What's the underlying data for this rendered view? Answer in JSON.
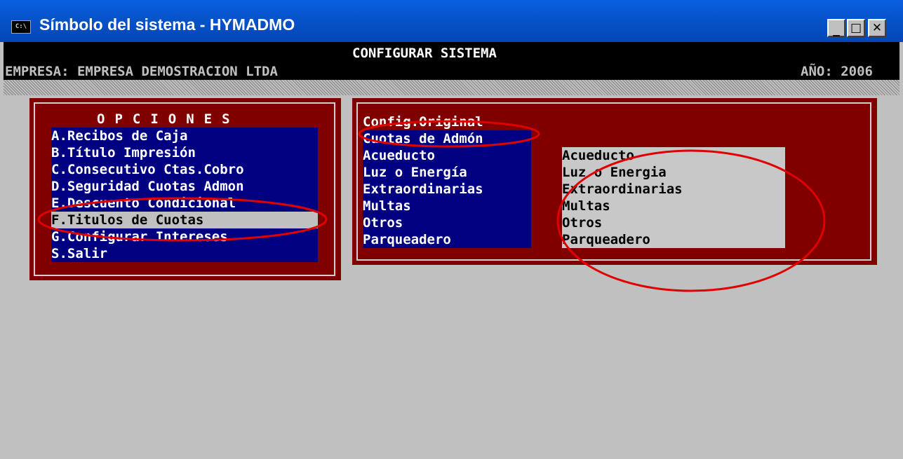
{
  "window": {
    "title": "Símbolo del sistema - HYMADMO",
    "icon": "cmd-icon"
  },
  "controls": {
    "minimize": "_",
    "maximize": "□",
    "close": "✕"
  },
  "header": {
    "screen_title": "CONFIGURAR SISTEMA",
    "company": "EMPRESA: EMPRESA DEMOSTRACION LTDA",
    "year": "AÑO: 2006"
  },
  "menu": {
    "title": "OPCIONES",
    "items": [
      "A.Recibos de Caja",
      "B.Título Impresión",
      "C.Consecutivo Ctas.Cobro",
      "D.Seguridad Cuotas Admon",
      "E.Descuento Condicional",
      "F.Titulos de Cuotas",
      "G.Configurar Intereses",
      "S.Salir"
    ],
    "selected": "F.Titulos de Cuotas"
  },
  "right_panel": {
    "labels": [
      "Config.Original",
      "Cuotas de Admón",
      "Acueducto",
      "Luz o Energía",
      "Extraordinarias",
      "Multas",
      "Otros",
      "Parqueadero"
    ],
    "values": [
      "Acueducto",
      "Luz o Energia",
      "Extraordinarias",
      "Multas",
      "Otros",
      "Parqueadero"
    ]
  },
  "colors": {
    "background": "#c0c0c0",
    "panel": "#800000",
    "menu_bg": "#000080",
    "title_bar": "#0653c9",
    "annotation": "#ff0000"
  }
}
